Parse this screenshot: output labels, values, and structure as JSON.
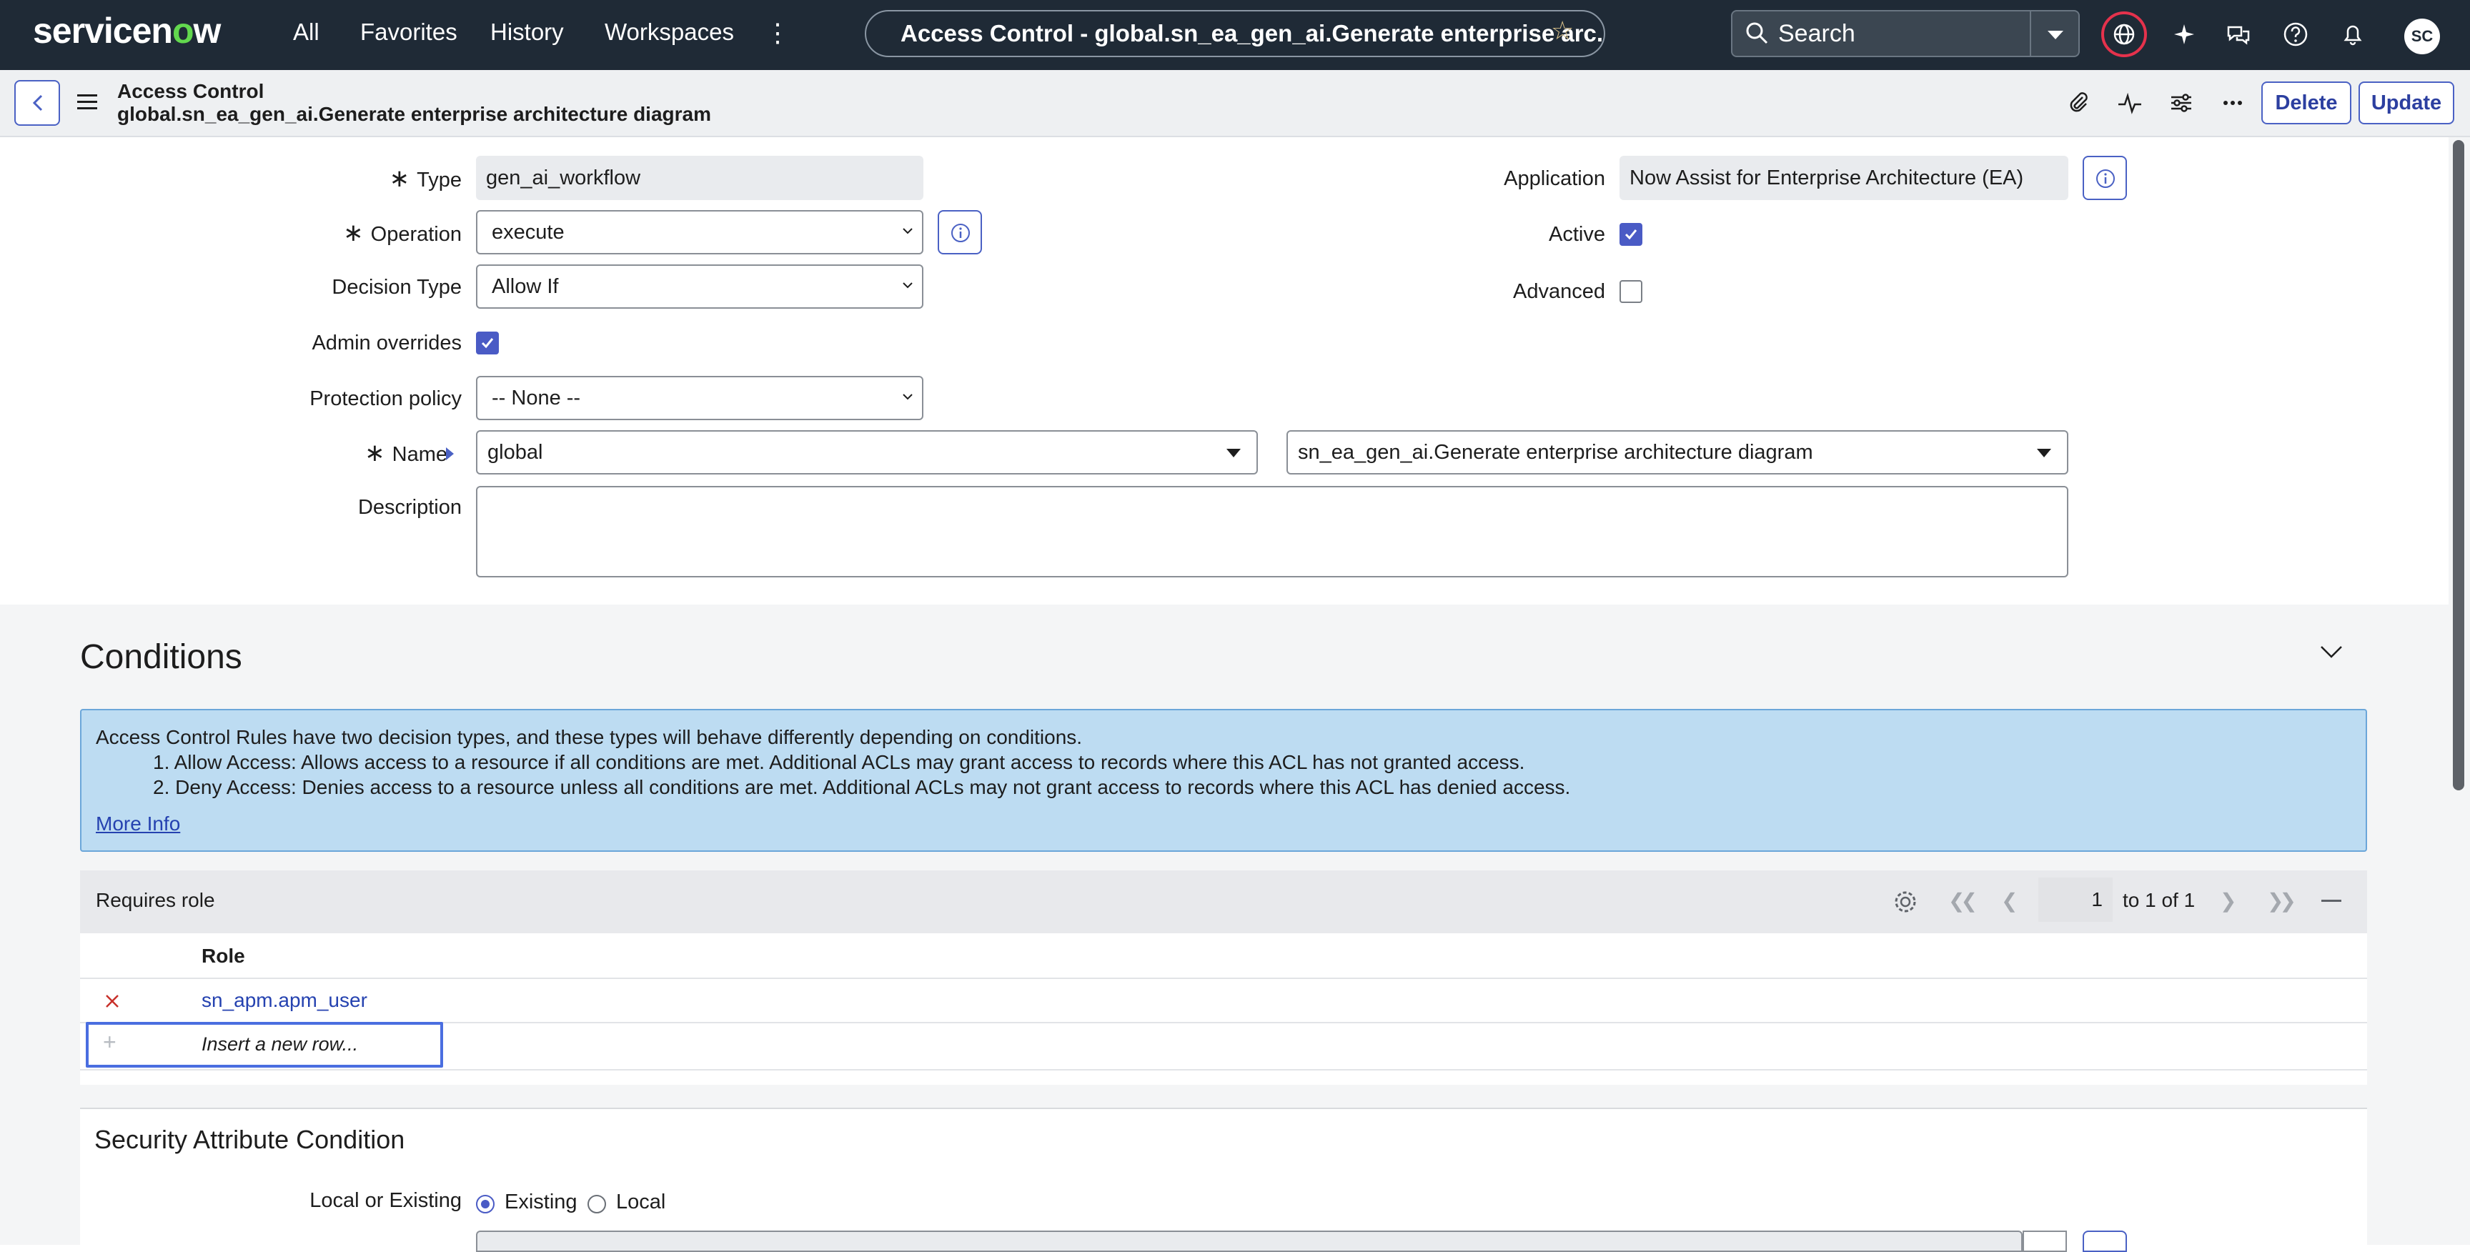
{
  "nav": {
    "logo_prefix": "servicen",
    "logo_o": "o",
    "logo_suffix": "w",
    "links": [
      "All",
      "Favorites",
      "History",
      "Workspaces"
    ],
    "record_title": "Access Control - global.sn_ea_gen_ai.Generate enterprise arc...",
    "search_placeholder": "Search",
    "avatar_initials": "SC"
  },
  "header": {
    "title_line1": "Access Control",
    "title_line2": "global.sn_ea_gen_ai.Generate enterprise architecture diagram",
    "delete_label": "Delete",
    "update_label": "Update"
  },
  "form": {
    "type_label": "Type",
    "type_value": "gen_ai_workflow",
    "operation_label": "Operation",
    "operation_value": "execute",
    "decision_type_label": "Decision Type",
    "decision_type_value": "Allow If",
    "admin_overrides_label": "Admin overrides",
    "admin_overrides_checked": true,
    "protection_policy_label": "Protection policy",
    "protection_policy_value": "-- None --",
    "name_label": "Name",
    "name_scope_value": "global",
    "name_value": "sn_ea_gen_ai.Generate enterprise architecture diagram",
    "description_label": "Description",
    "description_value": "",
    "application_label": "Application",
    "application_value": "Now Assist for Enterprise Architecture (EA)",
    "active_label": "Active",
    "active_checked": true,
    "advanced_label": "Advanced",
    "advanced_checked": false
  },
  "conditions": {
    "title": "Conditions",
    "info_line1": "Access Control Rules have two decision types, and these types will behave differently depending on conditions.",
    "info_line2": "1. Allow Access: Allows access to a resource if all conditions are met. Additional ACLs may grant access to records where this ACL has not granted access.",
    "info_line3": "2. Deny Access: Denies access to a resource unless all conditions are met. Additional ACLs may not grant access to records where this ACL has denied access.",
    "more_info": "More Info"
  },
  "requires_role": {
    "title": "Requires role",
    "page_input": "1",
    "page_text": "to 1 of 1",
    "column_role": "Role",
    "rows": [
      {
        "role": "sn_apm.apm_user"
      }
    ],
    "insert_row": "Insert a new row..."
  },
  "security_attr": {
    "title": "Security Attribute Condition",
    "local_or_existing_label": "Local or Existing",
    "option_existing": "Existing",
    "option_local": "Local",
    "selected": "Existing"
  },
  "colors": {
    "nav_bg": "#1f2a36",
    "accent": "#4a5bc5",
    "info_bg": "#bddcf2",
    "link": "#2542b0",
    "logo_accent": "#62d84e"
  }
}
